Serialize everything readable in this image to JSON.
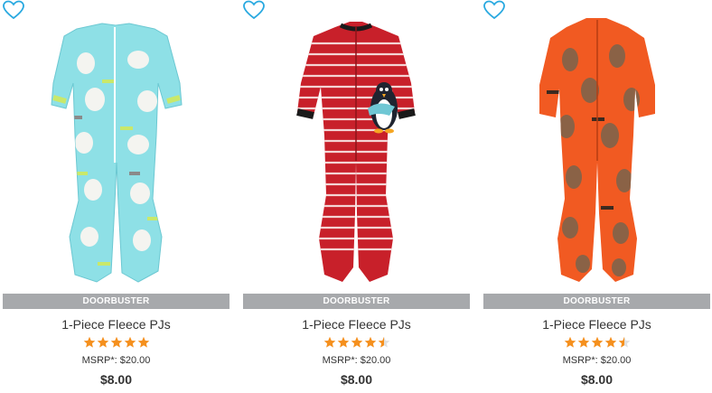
{
  "colors": {
    "accent": "#29a9e0",
    "banner": "#a7a9ac",
    "star": "#f5901e"
  },
  "products": [
    {
      "banner": "DOORBUSTER",
      "title": "1-Piece Fleece PJs",
      "rating": 5.0,
      "msrp": "MSRP*: $20.00",
      "price": "$8.00",
      "image": "light-blue-polar-bear-footed-pajamas",
      "favorite_icon": "heart-outline-icon"
    },
    {
      "banner": "DOORBUSTER",
      "title": "1-Piece Fleece PJs",
      "rating": 4.5,
      "msrp": "MSRP*: $20.00",
      "price": "$8.00",
      "image": "red-striped-penguin-footed-pajamas",
      "favorite_icon": "heart-outline-icon"
    },
    {
      "banner": "DOORBUSTER",
      "title": "1-Piece Fleece PJs",
      "rating": 4.5,
      "msrp": "MSRP*: $20.00",
      "price": "$8.00",
      "image": "orange-bear-footed-pajamas",
      "favorite_icon": "heart-outline-icon"
    }
  ]
}
